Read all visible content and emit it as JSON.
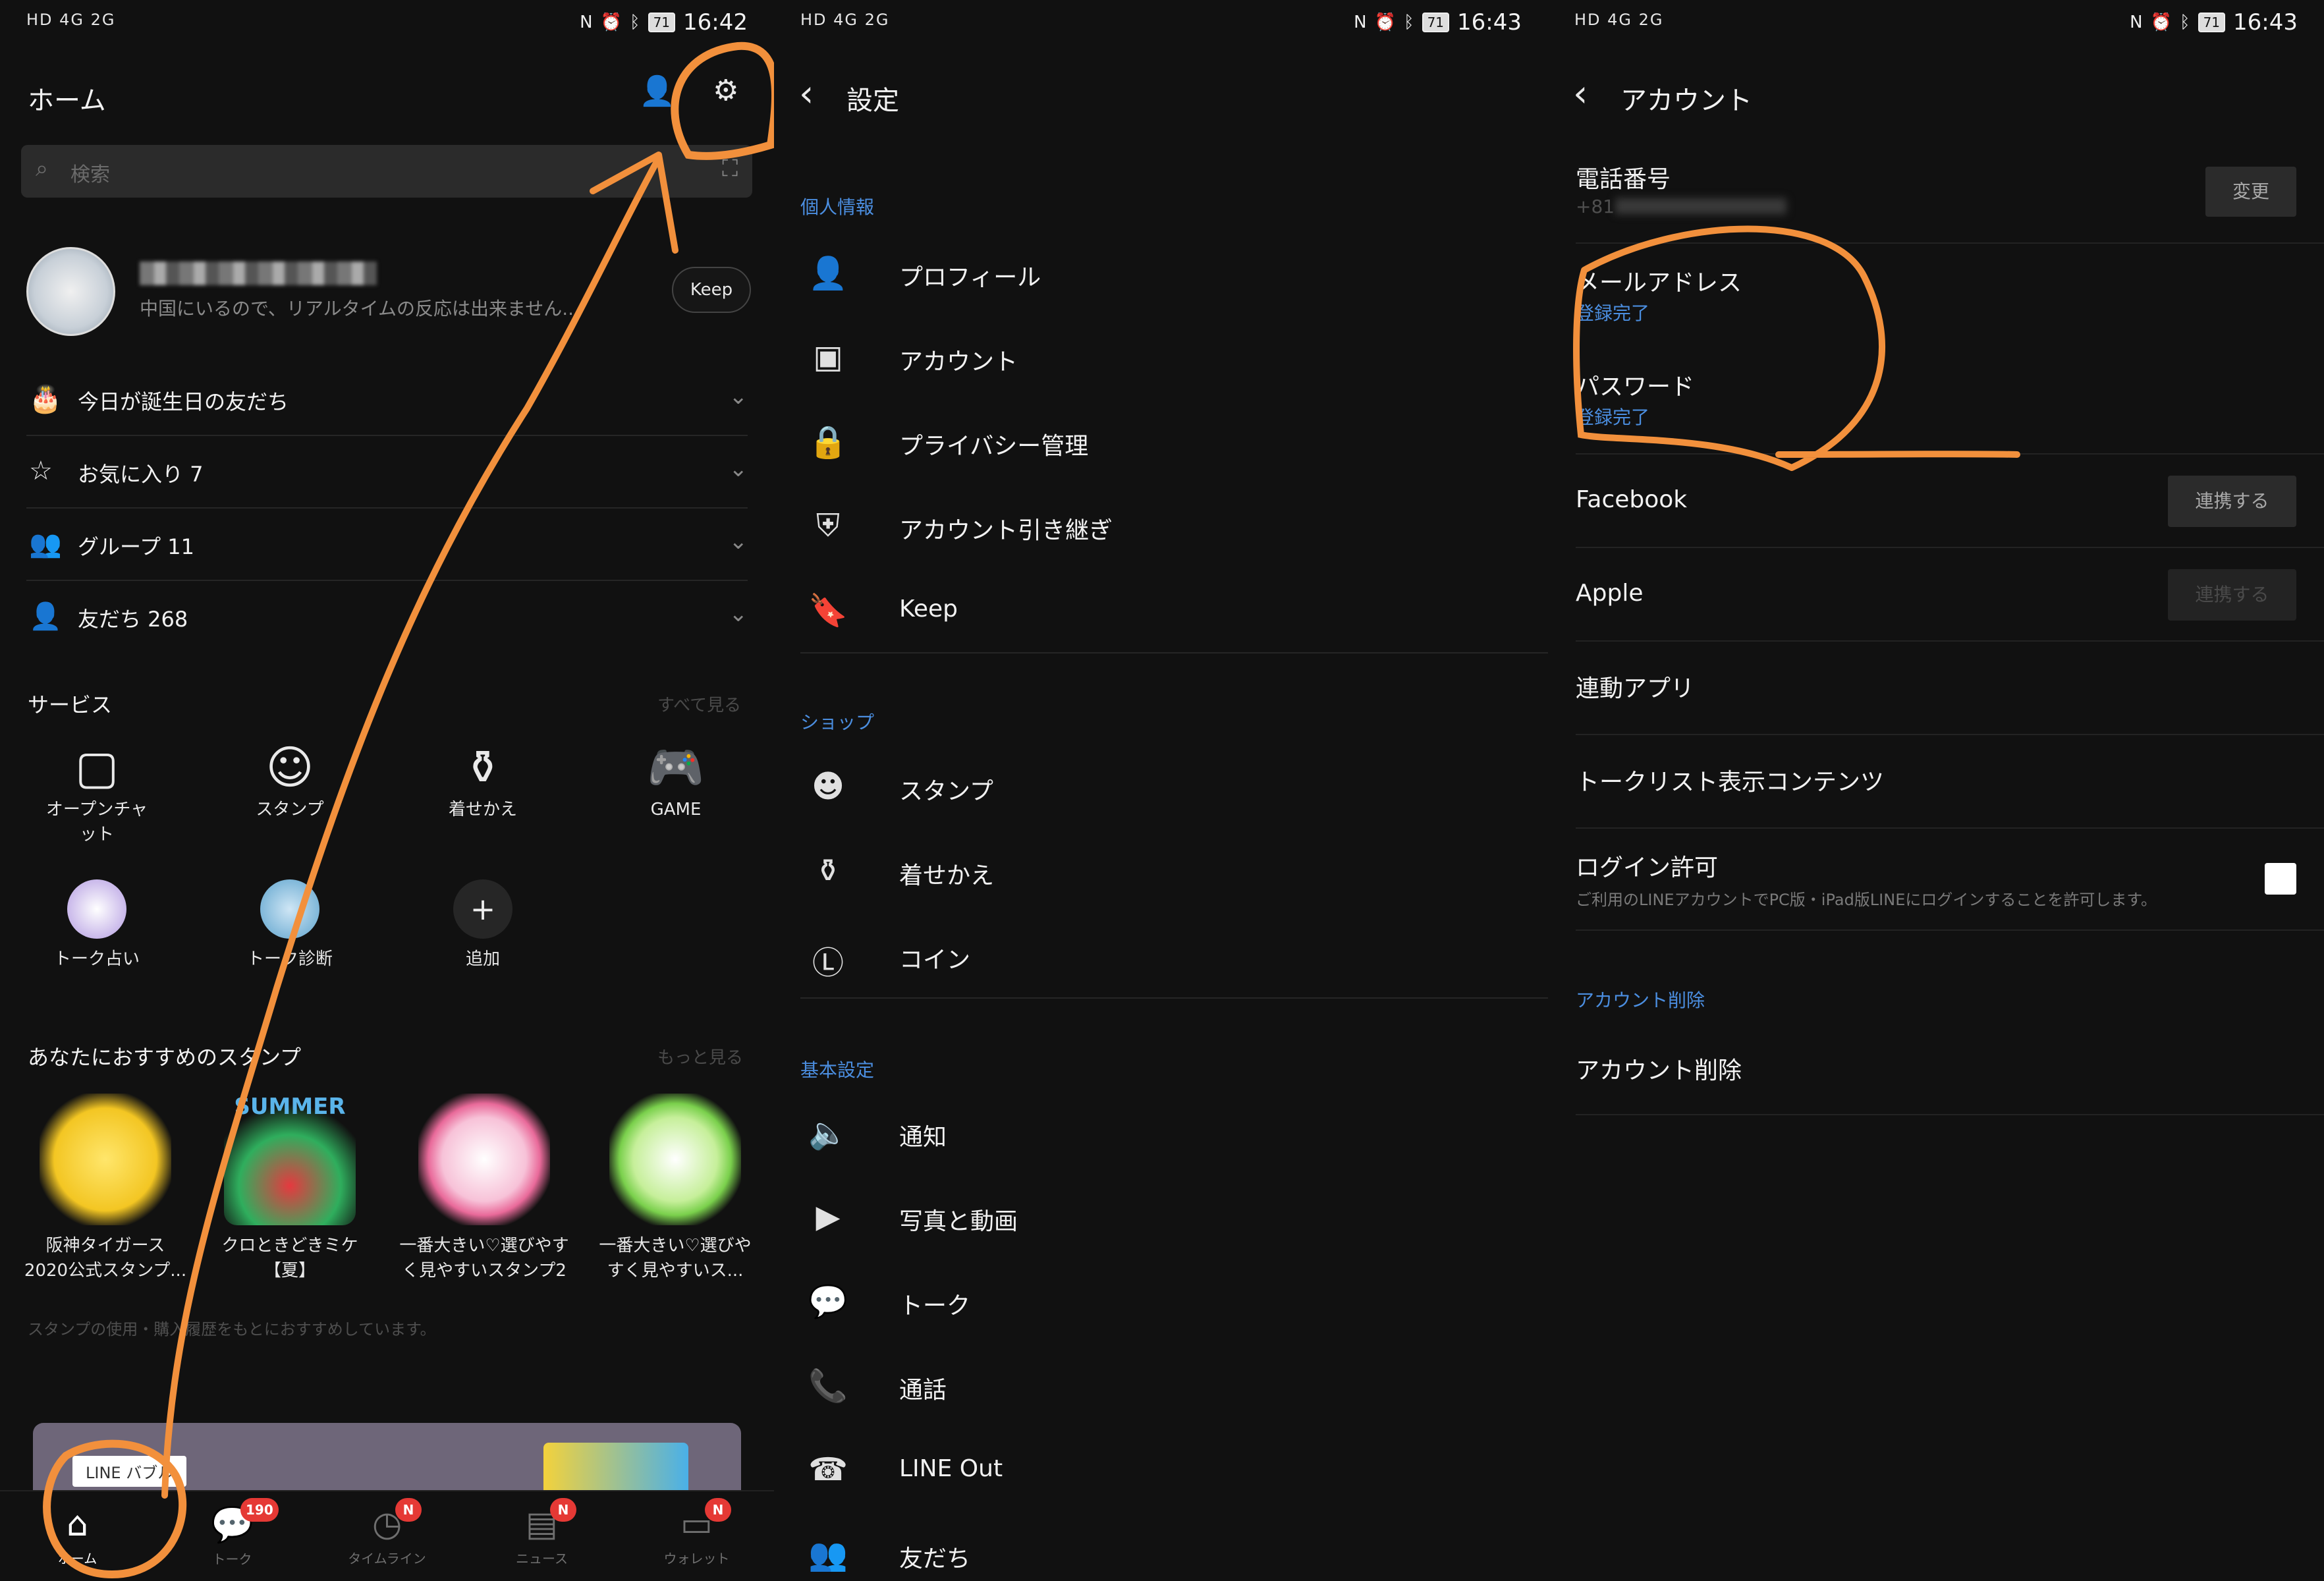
{
  "status_bars": [
    {
      "left": "HD 4G 2G",
      "time": "16:42",
      "battery": "71"
    },
    {
      "left": "HD 4G 2G",
      "time": "16:43",
      "battery": "71"
    },
    {
      "left": "HD 4G 2G",
      "time": "16:43",
      "battery": "71"
    }
  ],
  "home": {
    "title": "ホーム",
    "search_placeholder": "検索",
    "profile_status": "中国にいるので、リアルタイムの反応は出来ません...",
    "keep_label": "Keep",
    "friend_rows": [
      {
        "icon": "cake-icon",
        "label": "今日が誕生日の友だち"
      },
      {
        "icon": "star-icon",
        "label": "お気に入り 7"
      },
      {
        "icon": "group-icon",
        "label": "グループ 11"
      },
      {
        "icon": "person-icon",
        "label": "友だち 268"
      }
    ],
    "services_title": "サービス",
    "services_more": "すべて見る",
    "services": [
      {
        "icon": "openchat-icon",
        "label": "オープンチャット"
      },
      {
        "icon": "smile-icon",
        "label": "スタンプ"
      },
      {
        "icon": "brush-icon",
        "label": "着せかえ"
      },
      {
        "icon": "gamepad-icon",
        "label": "GAME"
      },
      {
        "icon": "fortune-icon",
        "label": "トーク占い"
      },
      {
        "icon": "talkcard-icon",
        "label": "トーク診断"
      },
      {
        "icon": "plus-icon",
        "label": "追加"
      }
    ],
    "stickers_title": "あなたにおすすめのスタンプ",
    "stickers_more": "もっと見る",
    "stickers": [
      {
        "label1": "阪神タイガース",
        "label2": "2020公式スタンプ...",
        "color": "#f3c623"
      },
      {
        "label1": "クロときどきミケ",
        "label2": "【夏】",
        "color": "#2fae5d"
      },
      {
        "label1": "一番大きい♡選びやす",
        "label2": "く見やすいスタンプ2",
        "color": "#e96a9a"
      },
      {
        "label1": "一番大きい♡選びや",
        "label2": "すく見やすいス...",
        "color": "#7ad04c"
      }
    ],
    "sticker_banner_text": "SUMMER",
    "note": "スタンプの使用・購入履歴をもとにおすすめしています。",
    "banner_label": "LINE バブル",
    "tabs": [
      {
        "icon": "home-icon",
        "label": "ホーム",
        "badge": ""
      },
      {
        "icon": "chat-icon",
        "label": "トーク",
        "badge": "190"
      },
      {
        "icon": "clock-icon",
        "label": "タイムライン",
        "badge": "N"
      },
      {
        "icon": "news-icon",
        "label": "ニュース",
        "badge": "N"
      },
      {
        "icon": "wallet-icon",
        "label": "ウォレット",
        "badge": "N"
      }
    ]
  },
  "settings": {
    "title": "設定",
    "groups": [
      {
        "label": "個人情報"
      },
      {
        "label": "ショップ"
      },
      {
        "label": "基本設定"
      }
    ],
    "items": [
      {
        "icon": "person-icon",
        "label": "プロフィール"
      },
      {
        "icon": "id-card-icon",
        "label": "アカウント"
      },
      {
        "icon": "lock-icon",
        "label": "プライバシー管理"
      },
      {
        "icon": "shield-icon",
        "label": "アカウント引き継ぎ"
      },
      {
        "icon": "bookmark-icon",
        "label": "Keep"
      },
      {
        "icon": "smile-icon",
        "label": "スタンプ"
      },
      {
        "icon": "brush-icon",
        "label": "着せかえ"
      },
      {
        "icon": "coin-icon",
        "label": "コイン"
      },
      {
        "icon": "speaker-icon",
        "label": "通知"
      },
      {
        "icon": "play-icon",
        "label": "写真と動画"
      },
      {
        "icon": "chat-bubble-icon",
        "label": "トーク"
      },
      {
        "icon": "phone-icon",
        "label": "通話"
      },
      {
        "icon": "phone-out-icon",
        "label": "LINE Out"
      },
      {
        "icon": "friends-icon",
        "label": "友だち"
      }
    ]
  },
  "account": {
    "title": "アカウント",
    "phone_label": "電話番号",
    "phone_value": "+81",
    "change_btn": "変更",
    "email_label": "メールアドレス",
    "email_status": "登録完了",
    "password_label": "パスワード",
    "password_status": "登録完了",
    "facebook_label": "Facebook",
    "facebook_btn": "連携する",
    "apple_label": "Apple",
    "apple_btn": "連携する",
    "apps_label": "連動アプリ",
    "talklist_label": "トークリスト表示コンテンツ",
    "login_label": "ログイン許可",
    "login_desc": "ご利用のLINEアカウントでPC版・iPad版LINEにログインすることを許可します。",
    "delete_group": "アカウント削除",
    "delete_label": "アカウント削除"
  },
  "annotation_color": "#f2903c"
}
